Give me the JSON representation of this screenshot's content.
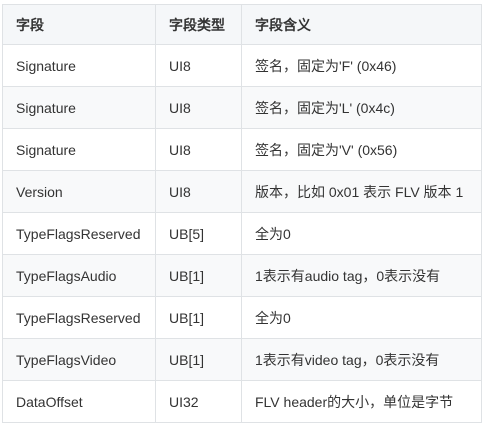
{
  "table": {
    "headers": [
      "字段",
      "字段类型",
      "字段含义"
    ],
    "rows": [
      [
        "Signature",
        "UI8",
        "签名，固定为'F' (0x46)"
      ],
      [
        "Signature",
        "UI8",
        "签名，固定为'L' (0x4c)"
      ],
      [
        "Signature",
        "UI8",
        "签名，固定为'V' (0x56)"
      ],
      [
        "Version",
        "UI8",
        "版本，比如 0x01 表示 FLV 版本 1"
      ],
      [
        "TypeFlagsReserved",
        "UB[5]",
        "全为0"
      ],
      [
        "TypeFlagsAudio",
        "UB[1]",
        "1表示有audio tag，0表示没有"
      ],
      [
        "TypeFlagsReserved",
        "UB[1]",
        "全为0"
      ],
      [
        "TypeFlagsVideo",
        "UB[1]",
        "1表示有video tag，0表示没有"
      ],
      [
        "DataOffset",
        "UI32",
        "FLV header的大小，单位是字节"
      ]
    ]
  },
  "colors": {
    "border": "#dfe2e5",
    "header_bg": "#f5f7f9",
    "stripe_bg": "#f8f9fa",
    "text": "#333333"
  }
}
